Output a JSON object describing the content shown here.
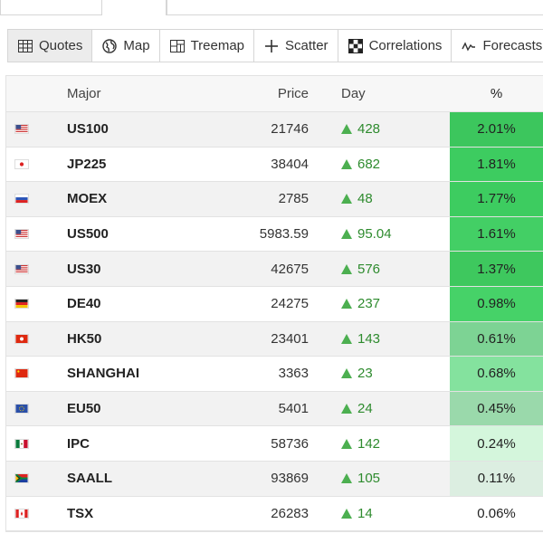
{
  "tabs": [
    {
      "label": "Quotes",
      "icon": "table-icon",
      "active": true
    },
    {
      "label": "Map",
      "icon": "globe-icon",
      "active": false
    },
    {
      "label": "Treemap",
      "icon": "treemap-icon",
      "active": false
    },
    {
      "label": "Scatter",
      "icon": "scatter-icon",
      "active": false
    },
    {
      "label": "Correlations",
      "icon": "grid-icon",
      "active": false
    },
    {
      "label": "Forecasts",
      "icon": "trend-icon",
      "active": false
    }
  ],
  "table": {
    "headers": {
      "name": "Major",
      "price": "Price",
      "day": "Day",
      "pct": "%"
    },
    "up_color": "#4caf50",
    "rows": [
      {
        "flag": "us",
        "name": "US100",
        "price": "21746",
        "day": "428",
        "pct": "2.01%",
        "pct_color": "#3cc65d"
      },
      {
        "flag": "jp",
        "name": "JP225",
        "price": "38404",
        "day": "682",
        "pct": "1.81%",
        "pct_color": "#3dcc60"
      },
      {
        "flag": "ru",
        "name": "MOEX",
        "price": "2785",
        "day": "48",
        "pct": "1.77%",
        "pct_color": "#3dcc60"
      },
      {
        "flag": "us",
        "name": "US500",
        "price": "5983.59",
        "day": "95.04",
        "pct": "1.61%",
        "pct_color": "#43cf65"
      },
      {
        "flag": "us",
        "name": "US30",
        "price": "42675",
        "day": "576",
        "pct": "1.37%",
        "pct_color": "#3ec85e"
      },
      {
        "flag": "de",
        "name": "DE40",
        "price": "24275",
        "day": "237",
        "pct": "0.98%",
        "pct_color": "#46d268"
      },
      {
        "flag": "hk",
        "name": "HK50",
        "price": "23401",
        "day": "143",
        "pct": "0.61%",
        "pct_color": "#7dd394"
      },
      {
        "flag": "cn",
        "name": "SHANGHAI",
        "price": "3363",
        "day": "23",
        "pct": "0.68%",
        "pct_color": "#84e29e"
      },
      {
        "flag": "eu",
        "name": "EU50",
        "price": "5401",
        "day": "24",
        "pct": "0.45%",
        "pct_color": "#9ad9ab"
      },
      {
        "flag": "mx",
        "name": "IPC",
        "price": "58736",
        "day": "142",
        "pct": "0.24%",
        "pct_color": "#d4f6dc"
      },
      {
        "flag": "za",
        "name": "SAALL",
        "price": "93869",
        "day": "105",
        "pct": "0.11%",
        "pct_color": "#dceee1"
      },
      {
        "flag": "ca",
        "name": "TSX",
        "price": "26283",
        "day": "14",
        "pct": "0.06%",
        "pct_color": "#ffffff"
      }
    ]
  }
}
